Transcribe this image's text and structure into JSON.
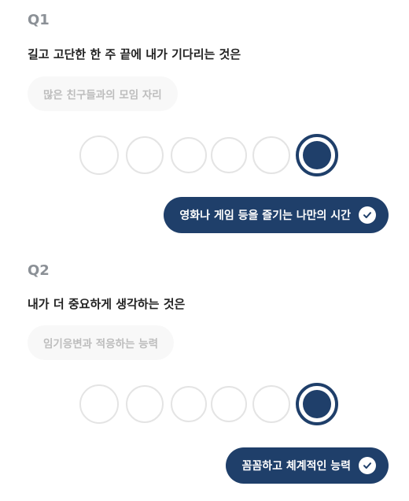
{
  "questions": [
    {
      "label": "Q1",
      "text": "길고 고단한 한 주 끝에 내가 기다리는 것은",
      "left_option": "많은 친구들과의 모임 자리",
      "right_option": "영화나 게임 등을 즐기는 나만의 시간",
      "scale_points": 6,
      "selected_index": 6
    },
    {
      "label": "Q2",
      "text": "내가 더 중요하게 생각하는 것은",
      "left_option": "임기응변과 적응하는 능력",
      "right_option": "꼼꼼하고 체계적인 능력",
      "scale_points": 6,
      "selected_index": 6
    }
  ],
  "colors": {
    "accent": "#1f3f6a",
    "circle_border": "#e4e4e4",
    "muted_text": "#bdbdbd"
  },
  "icons": {
    "answer_check": "check-circle-icon"
  }
}
